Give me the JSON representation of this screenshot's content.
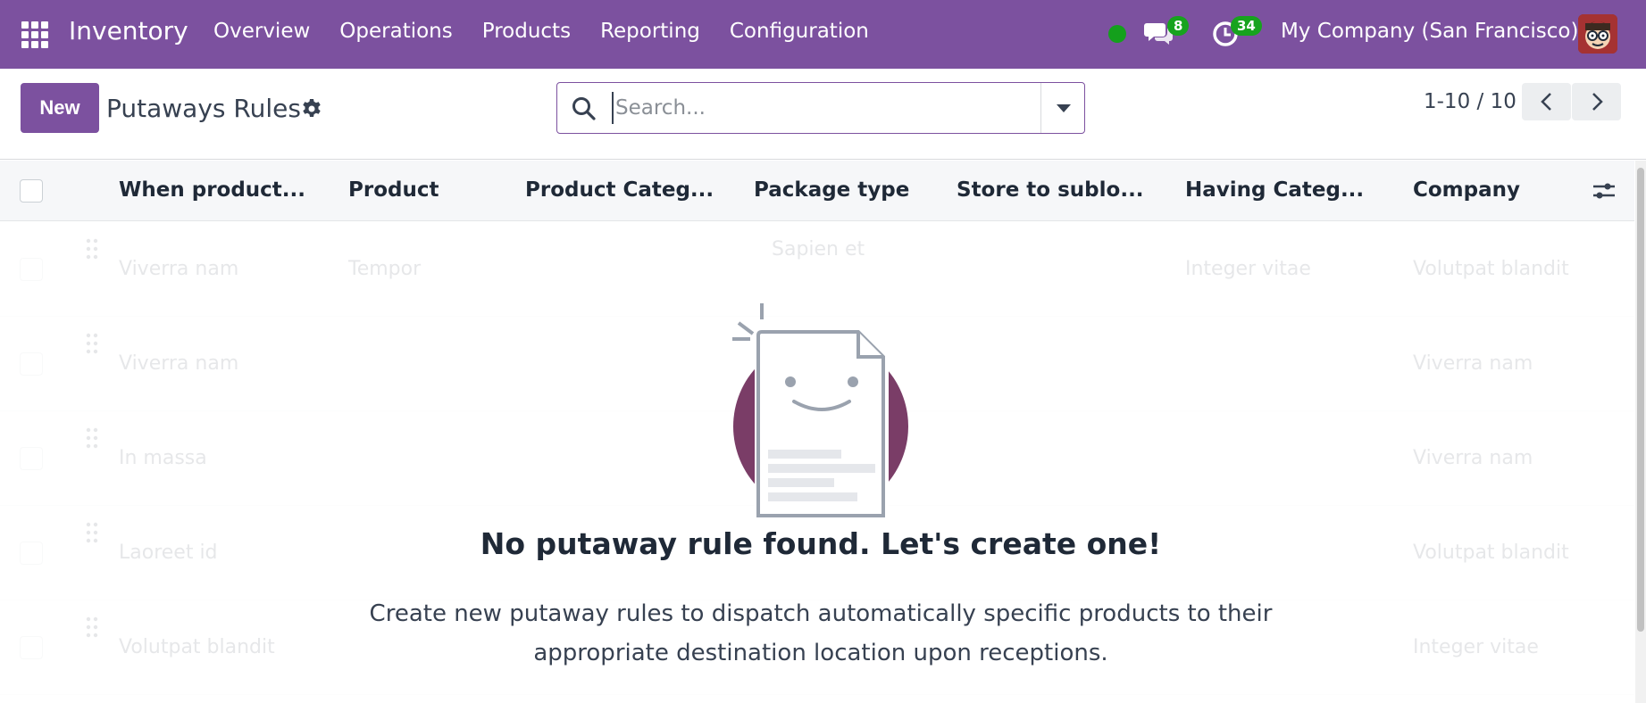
{
  "navbar": {
    "app_name": "Inventory",
    "menu": [
      "Overview",
      "Operations",
      "Products",
      "Reporting",
      "Configuration"
    ],
    "messages_count": "8",
    "activities_count": "34",
    "company": "My Company (San Francisco)"
  },
  "control": {
    "new_label": "New",
    "title": "Putaways Rules",
    "search_placeholder": "Search...",
    "pager": "1-10 / 10"
  },
  "table": {
    "columns": [
      "When product...",
      "Product",
      "Product Categ...",
      "Package type",
      "Store to sublo...",
      "Having Categ...",
      "Company"
    ],
    "rows": [
      {
        "when": "Viverra nam",
        "product": "Tempor",
        "package": "Sapien et",
        "having": "Integer vitae",
        "company": "Volutpat blandit"
      },
      {
        "when": "Viverra nam",
        "product": "",
        "package": "",
        "having": "",
        "company": "Viverra nam"
      },
      {
        "when": "In massa",
        "product": "",
        "package": "",
        "having": "",
        "company": "Viverra nam"
      },
      {
        "when": "Laoreet id",
        "product": "",
        "package": "",
        "having": "",
        "company": "Volutpat blandit"
      },
      {
        "when": "Volutpat blandit",
        "product": "",
        "package": "",
        "having": "",
        "company": "Integer vitae"
      }
    ]
  },
  "empty_state": {
    "title": "No putaway rule found. Let's create one!",
    "text": "Create new putaway rules to dispatch automatically specific products to their appropriate destination location upon receptions."
  },
  "colors": {
    "brand": "#7c519f",
    "badge": "#17a31e",
    "online": "#14a01c"
  }
}
